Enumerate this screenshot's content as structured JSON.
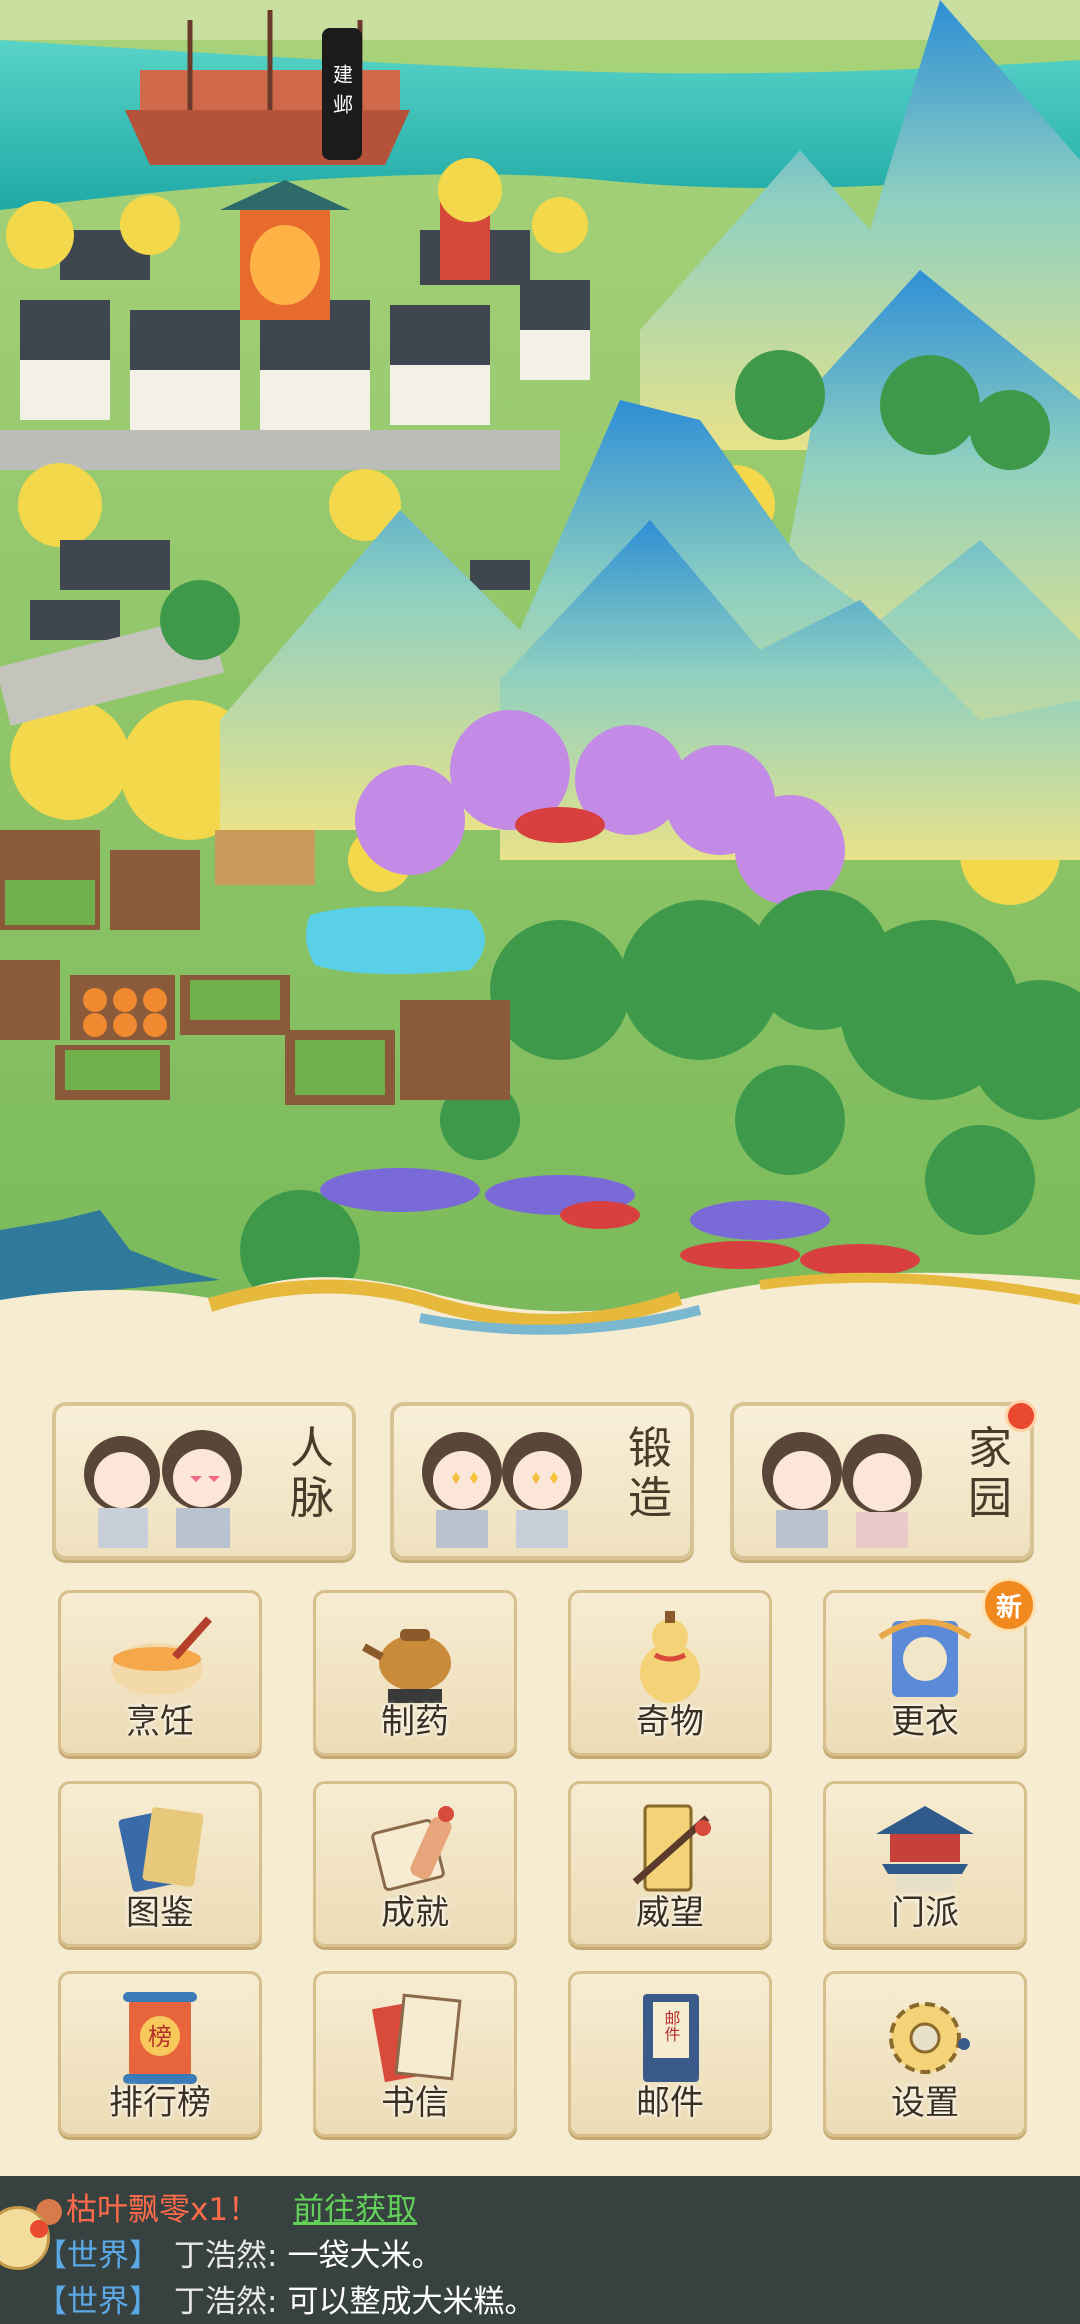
{
  "map": {
    "city_banner": "建邺"
  },
  "feature_cards": [
    {
      "label": "人脉",
      "has_red_dot": false
    },
    {
      "label": "锻造",
      "has_red_dot": false
    },
    {
      "label": "家园",
      "has_red_dot": true
    }
  ],
  "menu": [
    {
      "label": "烹饪",
      "icon": "cooking-bowl-icon"
    },
    {
      "label": "制药",
      "icon": "medicine-pot-icon"
    },
    {
      "label": "奇物",
      "icon": "gourd-icon"
    },
    {
      "label": "更衣",
      "icon": "wardrobe-icon",
      "badge": "新"
    },
    {
      "label": "图鉴",
      "icon": "cards-icon"
    },
    {
      "label": "成就",
      "icon": "scroll-icon"
    },
    {
      "label": "威望",
      "icon": "book-brush-icon"
    },
    {
      "label": "门派",
      "icon": "temple-icon"
    },
    {
      "label": "排行榜",
      "icon": "ranking-scroll-icon",
      "icon_text": "榜"
    },
    {
      "label": "书信",
      "icon": "letter-icon"
    },
    {
      "label": "邮件",
      "icon": "mail-icon",
      "icon_text": "邮件"
    },
    {
      "label": "设置",
      "icon": "gear-icon"
    }
  ],
  "chat": {
    "reward_text": "枯叶飘零x1！",
    "reward_action": "前往获取",
    "messages": [
      {
        "channel": "【世界】",
        "name": "丁浩然:",
        "text": "一袋大米。"
      },
      {
        "channel": "【世界】",
        "name": "丁浩然:",
        "text": "可以整成大米糕。"
      }
    ]
  },
  "colors": {
    "panel_bg": "#f6ecd2",
    "chat_bg": "#2d3a3a",
    "channel": "#5aa8e6",
    "reward": "#ff6b4a",
    "action_link": "#63d05a",
    "badge_orange": "#f08a1e",
    "red_dot": "#e8492f"
  }
}
